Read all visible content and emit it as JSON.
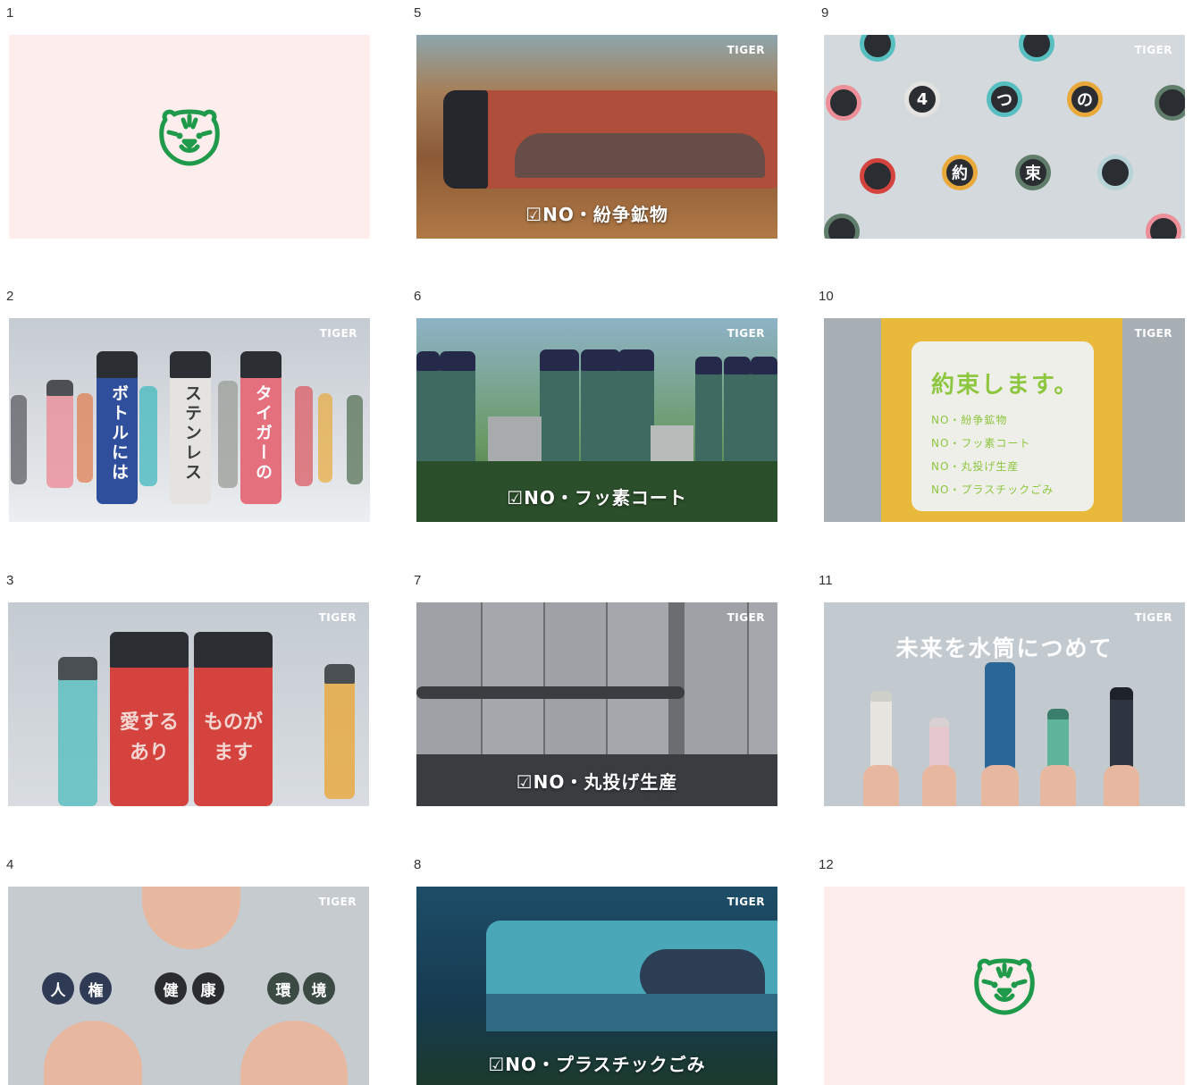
{
  "frames": [
    {
      "number": "1"
    },
    {
      "number": "2",
      "brand": "TIGER",
      "bottle_texts": [
        "ボトルには",
        "ステンレス",
        "タイガーの"
      ]
    },
    {
      "number": "3",
      "brand": "TIGER",
      "bottle_texts": [
        "愛する\nあり",
        "ものが\nます"
      ]
    },
    {
      "number": "4",
      "brand": "TIGER",
      "caps": [
        "人",
        "権",
        "健",
        "康",
        "環",
        "境"
      ]
    },
    {
      "number": "5",
      "brand": "TIGER",
      "caption": "☑NO・紛争鉱物"
    },
    {
      "number": "6",
      "brand": "TIGER",
      "caption": "☑NO・フッ素コート"
    },
    {
      "number": "7",
      "brand": "TIGER",
      "caption": "☑NO・丸投げ生産"
    },
    {
      "number": "8",
      "brand": "TIGER",
      "caption": "☑NO・プラスチックごみ"
    },
    {
      "number": "9",
      "brand": "TIGER",
      "caps": [
        "4",
        "つ",
        "の",
        "約",
        "束"
      ]
    },
    {
      "number": "10",
      "brand": "TIGER",
      "card_title": "約束します。",
      "card_items": [
        "NO・紛争鉱物",
        "NO・フッ素コート",
        "NO・丸投げ生産",
        "NO・プラスチックごみ"
      ]
    },
    {
      "number": "11",
      "brand": "TIGER",
      "headline": "未来を水筒につめて"
    },
    {
      "number": "12"
    }
  ],
  "colors": {
    "logo_green": "#1e9a4a",
    "pink_bg": "#fdeeed",
    "card_green": "#8dc63f"
  }
}
